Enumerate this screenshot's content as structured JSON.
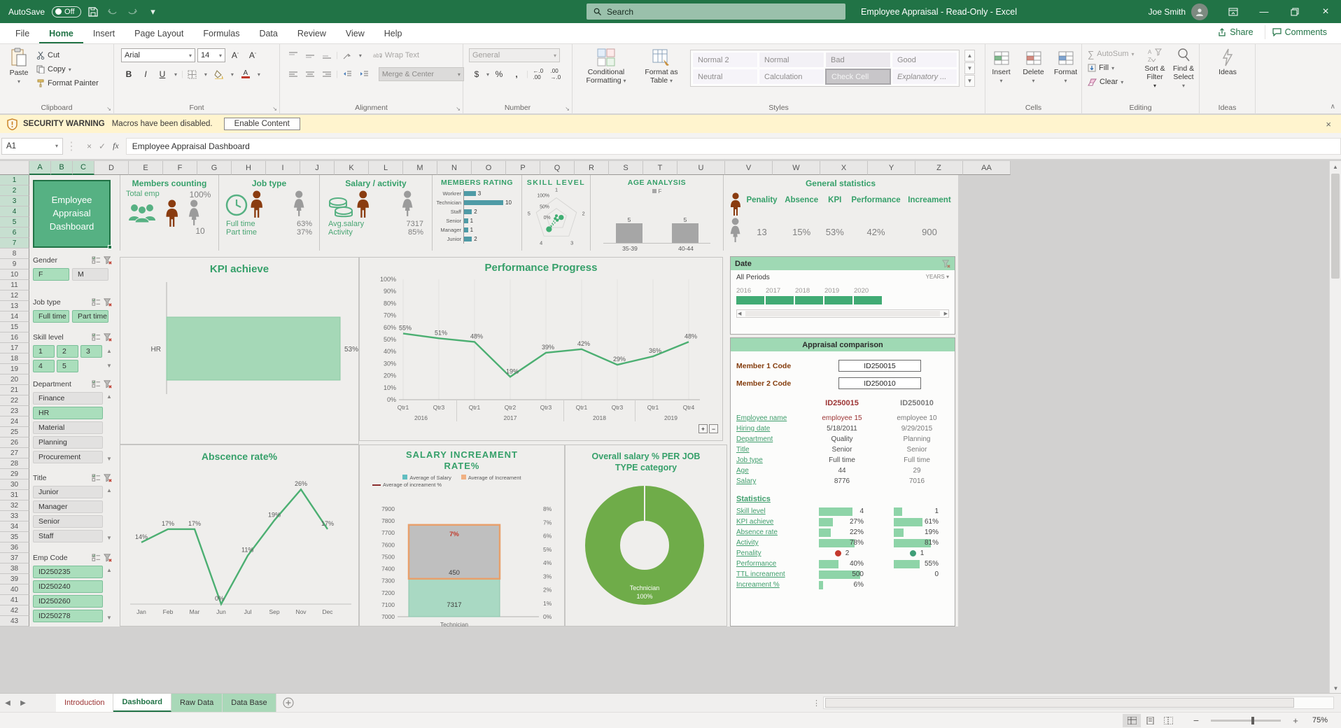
{
  "colors": {
    "accent": "#217346",
    "title_green": "#36a06a",
    "teal_bar": "#4f9ba6",
    "line_green": "#4caf72",
    "donut_green": "#6fac49",
    "slicer_green": "#aadebc",
    "male_icon": "#8a3c10",
    "female_icon": "#9b9b9b",
    "warning_bg": "#fff4ce"
  },
  "titlebar": {
    "autosave_label": "AutoSave",
    "autosave_state": "Off",
    "search_placeholder": "Search",
    "title": "Employee Appraisel  -  Read-Only  -  Excel",
    "title_text": "Employee Appraisal  -  Read-Only  -  Excel",
    "user_name": "Joe Smith"
  },
  "ribbon": {
    "tabs": [
      "File",
      "Home",
      "Insert",
      "Page Layout",
      "Formulas",
      "Data",
      "Review",
      "View",
      "Help"
    ],
    "active_tab": "Home",
    "share_label": "Share",
    "comments_label": "Comments",
    "clipboard": {
      "label": "Clipboard",
      "paste": "Paste",
      "cut": "Cut",
      "copy": "Copy",
      "format_painter": "Format Painter"
    },
    "font": {
      "label": "Font",
      "family": "Arial",
      "size": "14",
      "bold": "B",
      "italic": "I",
      "underline": "U"
    },
    "alignment": {
      "label": "Alignment",
      "wrap_text": "Wrap Text",
      "merge_center": "Merge & Center"
    },
    "number": {
      "label": "Number",
      "format": "General"
    },
    "styles": {
      "label": "Styles",
      "conditional_line1": "Conditional",
      "conditional_line2": "Formatting",
      "format_table_line1": "Format as",
      "format_table_line2": "Table",
      "gallery": [
        "Normal 2",
        "Normal",
        "Bad",
        "Good",
        "Neutral",
        "Calculation",
        "Check Cell",
        "Explanatory ..."
      ]
    },
    "cells": {
      "label": "Cells",
      "buttons": [
        "Insert",
        "Delete",
        "Format"
      ]
    },
    "editing": {
      "label": "Editing",
      "autosum": "AutoSum",
      "fill": "Fill",
      "clear": "Clear",
      "sort_filter": "Sort & Filter",
      "find_select": "Find & Select"
    },
    "ideas": {
      "label": "Ideas",
      "button": "Ideas"
    }
  },
  "security_bar": {
    "warning": "SECURITY WARNING",
    "message": "Macros have been disabled.",
    "button": "Enable Content"
  },
  "formula_bar": {
    "name_box": "A1",
    "fx": "fx",
    "value": "Employee Appraisal Dashboard"
  },
  "sheet": {
    "columns": [
      "A",
      "B",
      "C",
      "D",
      "E",
      "F",
      "G",
      "H",
      "I",
      "J",
      "K",
      "L",
      "M",
      "N",
      "O",
      "P",
      "Q",
      "R",
      "S",
      "T",
      "U",
      "V",
      "W",
      "X",
      "Y",
      "Z",
      "AA"
    ],
    "selected_columns": [
      "A",
      "B",
      "C"
    ],
    "row_count": 43,
    "selected_rows_to": 7
  },
  "dashboard": {
    "title": "Employee Appraisal Dashboard",
    "members_counting": {
      "title": "Members counting",
      "total_label": "Total emp",
      "pct": "100%",
      "count": "10"
    },
    "job_type": {
      "title": "Job type",
      "rows": [
        {
          "label": "Full time",
          "value": "63%"
        },
        {
          "label": "Part time",
          "value": "37%"
        }
      ]
    },
    "salary_activity": {
      "title": "Salary / activity",
      "rows": [
        {
          "label": "Avg.salary",
          "value": "7317"
        },
        {
          "label": "Activity",
          "value": "85%"
        }
      ]
    },
    "general_stats": {
      "title": "General statistics",
      "cols": [
        {
          "label": "Penality",
          "value": "13"
        },
        {
          "label": "Absence",
          "value": "15%"
        },
        {
          "label": "KPI",
          "value": "53%"
        },
        {
          "label": "Performance",
          "value": "42%"
        },
        {
          "label": "Increament",
          "value": "900"
        }
      ]
    }
  },
  "slicers": [
    {
      "title": "Gender",
      "items": [
        {
          "label": "F",
          "on": true
        },
        {
          "label": "M",
          "on": false
        }
      ]
    },
    {
      "title": "Job type",
      "items": [
        {
          "label": "Full time",
          "on": true
        },
        {
          "label": "Part time",
          "on": true
        }
      ]
    },
    {
      "title": "Skill level",
      "items": [
        {
          "label": "1",
          "on": true
        },
        {
          "label": "2",
          "on": true
        },
        {
          "label": "3",
          "on": true
        },
        {
          "label": "4",
          "on": true
        },
        {
          "label": "5",
          "on": true
        }
      ]
    },
    {
      "title": "Department",
      "items": [
        {
          "label": "Finance",
          "on": false
        },
        {
          "label": "HR",
          "on": true
        },
        {
          "label": "Material",
          "on": false
        },
        {
          "label": "Planning",
          "on": false
        },
        {
          "label": "Procurement",
          "on": false
        }
      ]
    },
    {
      "title": "Title",
      "items": [
        {
          "label": "Junior",
          "on": false
        },
        {
          "label": "Manager",
          "on": false
        },
        {
          "label": "Senior",
          "on": false
        },
        {
          "label": "Staff",
          "on": false
        }
      ]
    },
    {
      "title": "Emp Code",
      "items": [
        {
          "label": "ID250235",
          "on": true
        },
        {
          "label": "ID250240",
          "on": true
        },
        {
          "label": "ID250260",
          "on": true
        },
        {
          "label": "ID250278",
          "on": true
        }
      ]
    }
  ],
  "date_slicer": {
    "title": "Date",
    "period_label": "All Periods",
    "granularity": "YEARS",
    "years": [
      "2016",
      "2017",
      "2018",
      "2019",
      "2020"
    ]
  },
  "appraisal": {
    "title": "Appraisal comparison",
    "member1_label": "Member 1 Code",
    "member1_code": "ID250015",
    "member2_label": "Member 2 Code",
    "member2_code": "ID250010",
    "col1_header": "ID250015",
    "col2_header": "ID250010",
    "info_rows": [
      {
        "label": "Employee name",
        "v1": "employee 15",
        "v2": "employee 10",
        "v1red": true
      },
      {
        "label": "Hiring date",
        "v1": "5/18/2011",
        "v2": "9/29/2015"
      },
      {
        "label": "Department",
        "v1": "Quality",
        "v2": "Planning"
      },
      {
        "label": "Title",
        "v1": "Senior",
        "v2": "Senior"
      },
      {
        "label": "Job type",
        "v1": "Full time",
        "v2": "Full time"
      },
      {
        "label": "Age",
        "v1": "44",
        "v2": "29"
      },
      {
        "label": "Salary",
        "v1": "8776",
        "v2": "7016"
      }
    ],
    "stats_header": "Statistics",
    "stat_rows": [
      {
        "label": "Skill level",
        "v1": "4",
        "v2": "1",
        "b1": 0.72,
        "b2": 0.18
      },
      {
        "label": "KPI achieve",
        "v1": "27%",
        "v2": "61%",
        "b1": 0.3,
        "b2": 0.62
      },
      {
        "label": "Absence rate",
        "v1": "22%",
        "v2": "19%",
        "b1": 0.25,
        "b2": 0.21
      },
      {
        "label": "Activity",
        "v1": "78%",
        "v2": "81%",
        "b1": 0.78,
        "b2": 0.81
      },
      {
        "label": "Penality",
        "v1": "2",
        "v2": "1",
        "dot1": "#c4392d",
        "dot2": "#3f9e77"
      },
      {
        "label": "Performance",
        "v1": "40%",
        "v2": "55%",
        "b1": 0.42,
        "b2": 0.56
      },
      {
        "label": "TTL increament",
        "v1": "500",
        "v2": "0",
        "b1": 0.9,
        "b2": 0
      },
      {
        "label": "Increament %",
        "v1": "6%",
        "v2": "",
        "b1": 0.09,
        "b2": 0
      }
    ]
  },
  "chart_data": [
    {
      "id": "members_rating",
      "type": "bar",
      "orientation": "horizontal",
      "title": "MEMBERS RATING",
      "categories": [
        "Workrer",
        "Technician",
        "Staff",
        "Senior",
        "Manager",
        "Junior"
      ],
      "values": [
        3,
        10,
        2,
        1,
        1,
        2
      ],
      "xlabel": "",
      "ylabel": "",
      "color": "#4f9ba6"
    },
    {
      "id": "skill_level",
      "type": "radar",
      "title": "SKILL LEVEL",
      "axes": [
        "1",
        "2",
        "3",
        "4",
        "5"
      ],
      "ring_labels": [
        "100%",
        "50%",
        "0%"
      ],
      "values_fraction": [
        0.15,
        0.24,
        0.07,
        0.6,
        0.06
      ],
      "color": "#3fae72"
    },
    {
      "id": "age_analysis",
      "type": "bar",
      "title": "AGE ANALYSIS",
      "legend": [
        "F"
      ],
      "categories": [
        "35-39",
        "40-44"
      ],
      "values": [
        5,
        5
      ],
      "color": "#a6a6a6"
    },
    {
      "id": "kpi_achieve",
      "type": "bar",
      "orientation": "horizontal",
      "title": "KPI achieve",
      "categories": [
        "HR"
      ],
      "values": [
        53
      ],
      "value_labels": [
        "53%"
      ],
      "color": "#a5d8b7"
    },
    {
      "id": "performance",
      "type": "line",
      "title": "Performance Progress",
      "x": [
        "Qtr1",
        "Qtr3",
        "Qtr1",
        "Qtr2",
        "Qtr3",
        "Qtr1",
        "Qtr3",
        "Qtr1",
        "Qtr4"
      ],
      "year_groups": [
        {
          "label": "2016",
          "span": 2
        },
        {
          "label": "2017",
          "span": 3
        },
        {
          "label": "2018",
          "span": 2
        },
        {
          "label": "2019",
          "span": 2
        }
      ],
      "values": [
        55,
        51,
        48,
        19,
        39,
        42,
        29,
        36,
        48
      ],
      "value_labels": [
        "55%",
        "51%",
        "48%",
        "19%",
        "39%",
        "42%",
        "29%",
        "36%",
        "48%"
      ],
      "ylim": [
        0,
        100
      ],
      "yticks": [
        "100%",
        "90%",
        "80%",
        "70%",
        "60%",
        "50%",
        "40%",
        "30%",
        "20%",
        "10%",
        "0%"
      ],
      "grid": "vertical",
      "color": "#4caf72"
    },
    {
      "id": "abscence",
      "type": "line",
      "title": "Abscence rate%",
      "x": [
        "Jan",
        "Feb",
        "Mar",
        "Jun",
        "Jul",
        "Sep",
        "Nov",
        "Dec"
      ],
      "values": [
        14,
        17,
        17,
        0,
        11,
        19,
        26,
        17
      ],
      "value_labels": [
        "14%",
        "17%",
        "17%",
        "0%",
        "11%",
        "19%",
        "26%",
        "17%"
      ],
      "ylim": [
        0,
        30
      ],
      "color": "#4caf72"
    },
    {
      "id": "salary_increment",
      "type": "column-stacked",
      "title_line1": "SALARY INCREAMENT",
      "title_line2": "RATE%",
      "legend": [
        {
          "label": "Average of Salary",
          "color": "#62bec1"
        },
        {
          "label": "Average of Increament",
          "color": "#f0b183"
        },
        {
          "label": "Average of increament %",
          "color": "#8b2e2e",
          "marker": "line"
        }
      ],
      "categories": [
        "Technician"
      ],
      "left_axis": [
        "7900",
        "7800",
        "7700",
        "7600",
        "7500",
        "7400",
        "7300",
        "7200",
        "7100",
        "7000"
      ],
      "right_axis": [
        "8%",
        "7%",
        "6%",
        "5%",
        "4%",
        "3%",
        "2%",
        "1%",
        "0%"
      ],
      "segments": {
        "salary_value": 7317,
        "salary_label": "7317",
        "increment_value": 450,
        "increment_label": "450",
        "pct_label": "7%"
      }
    },
    {
      "id": "overall_salary",
      "type": "donut",
      "title_line1": "Overall salary % PER JOB",
      "title_line2": "TYPE category",
      "slices": [
        {
          "label": "Technician",
          "pct": "100%",
          "value": 100,
          "color": "#6fac49"
        }
      ]
    },
    {
      "id": "date_timeline",
      "type": "timeline",
      "years": [
        "2016",
        "2017",
        "2018",
        "2019",
        "2020"
      ],
      "color": "#41ab74"
    }
  ],
  "sheet_tabs": [
    {
      "label": "Introduction",
      "style": "intro"
    },
    {
      "label": "Dashboard",
      "style": "active"
    },
    {
      "label": "Raw Data",
      "style": "green"
    },
    {
      "label": "Data Base",
      "style": "green"
    }
  ],
  "status_bar": {
    "zoom": "75%"
  }
}
